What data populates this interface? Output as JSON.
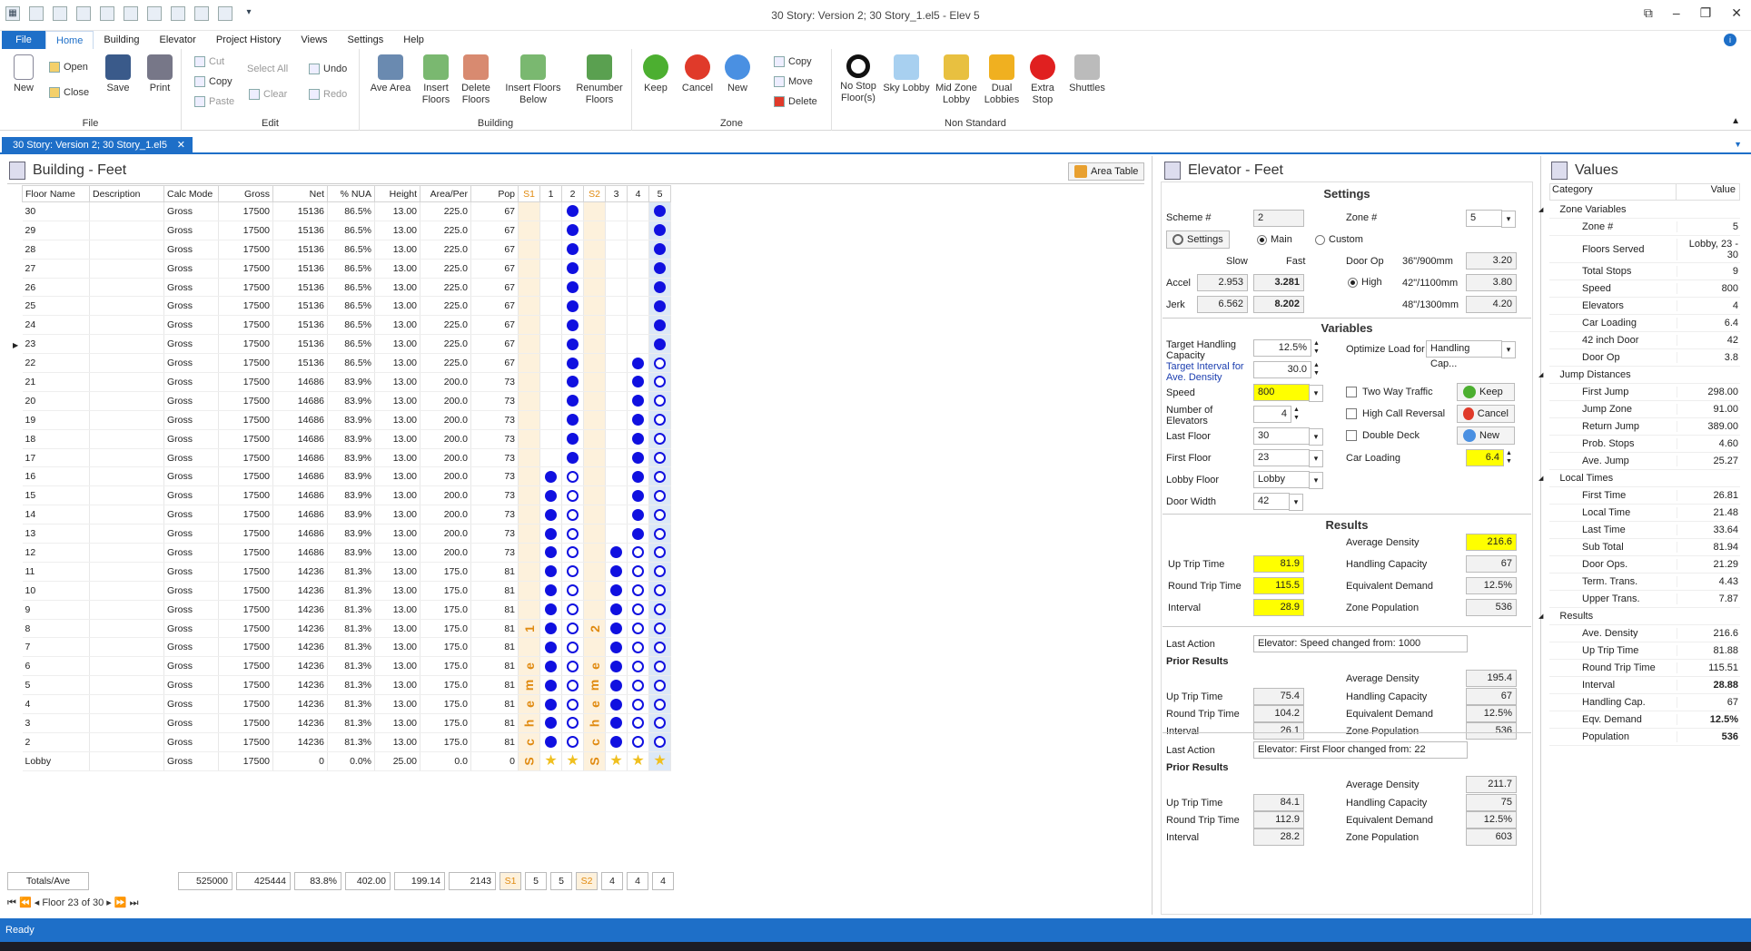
{
  "window": {
    "title": "30 Story: Version 2; 30 Story_1.el5 - Elev 5"
  },
  "menu": [
    "File",
    "Home",
    "Building",
    "Elevator",
    "Project History",
    "Views",
    "Settings",
    "Help"
  ],
  "ribbon": {
    "file": {
      "label": "File",
      "new": "New",
      "open": "Open",
      "close": "Close",
      "save": "Save",
      "print": "Print"
    },
    "edit": {
      "label": "Edit",
      "cut": "Cut",
      "copy": "Copy",
      "paste": "Paste",
      "select_all": "Select All",
      "clear": "Clear",
      "undo": "Undo",
      "redo": "Redo"
    },
    "building": {
      "label": "Building",
      "ave_area": "Ave Area",
      "insert_floors": "Insert Floors",
      "delete_floors": "Delete Floors",
      "insert_below": "Insert Floors Below",
      "renumber": "Renumber Floors"
    },
    "zone": {
      "label": "Zone",
      "keep": "Keep",
      "cancel": "Cancel",
      "new": "New",
      "copy": "Copy",
      "move": "Move",
      "delete": "Delete"
    },
    "nonstd": {
      "label": "Non Standard",
      "no_stop": "No Stop Floor(s)",
      "sky": "Sky Lobby",
      "mid": "Mid Zone Lobby",
      "dual": "Dual Lobbies",
      "extra": "Extra Stop",
      "shuttles": "Shuttles"
    }
  },
  "doc_tab": "30 Story: Version 2; 30 Story_1.el5",
  "building": {
    "title": "Building - Feet",
    "area_table_btn": "Area Table",
    "columns": [
      "Floor Name",
      "Description",
      "Calc Mode",
      "Gross",
      "Net",
      "% NUA",
      "Height",
      "Area/Per",
      "Pop",
      "S1",
      "1",
      "2",
      "S2",
      "3",
      "4",
      "5"
    ],
    "rows": [
      {
        "f": "30",
        "net": "15136",
        "nua": "86.5%",
        "ap": "225.0",
        "pop": "67",
        "z": [
          "",
          "",
          "f",
          "",
          "",
          "",
          "f"
        ]
      },
      {
        "f": "29",
        "net": "15136",
        "nua": "86.5%",
        "ap": "225.0",
        "pop": "67",
        "z": [
          "",
          "",
          "f",
          "",
          "",
          "",
          "f"
        ]
      },
      {
        "f": "28",
        "net": "15136",
        "nua": "86.5%",
        "ap": "225.0",
        "pop": "67",
        "z": [
          "",
          "",
          "f",
          "",
          "",
          "",
          "f"
        ]
      },
      {
        "f": "27",
        "net": "15136",
        "nua": "86.5%",
        "ap": "225.0",
        "pop": "67",
        "z": [
          "",
          "",
          "f",
          "",
          "",
          "",
          "f"
        ]
      },
      {
        "f": "26",
        "net": "15136",
        "nua": "86.5%",
        "ap": "225.0",
        "pop": "67",
        "z": [
          "",
          "",
          "f",
          "",
          "",
          "",
          "f"
        ]
      },
      {
        "f": "25",
        "net": "15136",
        "nua": "86.5%",
        "ap": "225.0",
        "pop": "67",
        "z": [
          "",
          "",
          "f",
          "",
          "",
          "",
          "f"
        ]
      },
      {
        "f": "24",
        "net": "15136",
        "nua": "86.5%",
        "ap": "225.0",
        "pop": "67",
        "z": [
          "",
          "",
          "f",
          "",
          "",
          "",
          "f"
        ]
      },
      {
        "f": "23",
        "net": "15136",
        "nua": "86.5%",
        "ap": "225.0",
        "pop": "67",
        "z": [
          "",
          "",
          "f",
          "",
          "",
          "",
          "f"
        ]
      },
      {
        "f": "22",
        "net": "15136",
        "nua": "86.5%",
        "ap": "225.0",
        "pop": "67",
        "z": [
          "",
          "",
          "f",
          "",
          "",
          "f",
          "o"
        ]
      },
      {
        "f": "21",
        "net": "14686",
        "nua": "83.9%",
        "ap": "200.0",
        "pop": "73",
        "z": [
          "",
          "",
          "f",
          "",
          "",
          "f",
          "o"
        ]
      },
      {
        "f": "20",
        "net": "14686",
        "nua": "83.9%",
        "ap": "200.0",
        "pop": "73",
        "z": [
          "",
          "",
          "f",
          "",
          "",
          "f",
          "o"
        ]
      },
      {
        "f": "19",
        "net": "14686",
        "nua": "83.9%",
        "ap": "200.0",
        "pop": "73",
        "z": [
          "",
          "",
          "f",
          "",
          "",
          "f",
          "o"
        ]
      },
      {
        "f": "18",
        "net": "14686",
        "nua": "83.9%",
        "ap": "200.0",
        "pop": "73",
        "z": [
          "",
          "",
          "f",
          "",
          "",
          "f",
          "o"
        ]
      },
      {
        "f": "17",
        "net": "14686",
        "nua": "83.9%",
        "ap": "200.0",
        "pop": "73",
        "z": [
          "",
          "",
          "f",
          "",
          "",
          "f",
          "o"
        ]
      },
      {
        "f": "16",
        "net": "14686",
        "nua": "83.9%",
        "ap": "200.0",
        "pop": "73",
        "z": [
          "",
          "f",
          "o",
          "",
          "",
          "f",
          "o"
        ]
      },
      {
        "f": "15",
        "net": "14686",
        "nua": "83.9%",
        "ap": "200.0",
        "pop": "73",
        "z": [
          "",
          "f",
          "o",
          "",
          "",
          "f",
          "o"
        ]
      },
      {
        "f": "14",
        "net": "14686",
        "nua": "83.9%",
        "ap": "200.0",
        "pop": "73",
        "z": [
          "",
          "f",
          "o",
          "",
          "",
          "f",
          "o"
        ]
      },
      {
        "f": "13",
        "net": "14686",
        "nua": "83.9%",
        "ap": "200.0",
        "pop": "73",
        "z": [
          "",
          "f",
          "o",
          "",
          "",
          "f",
          "o"
        ]
      },
      {
        "f": "12",
        "net": "14686",
        "nua": "83.9%",
        "ap": "200.0",
        "pop": "73",
        "z": [
          "",
          "f",
          "o",
          "",
          "f",
          "o",
          "o"
        ]
      },
      {
        "f": "11",
        "net": "14236",
        "nua": "81.3%",
        "ap": "175.0",
        "pop": "81",
        "z": [
          "",
          "f",
          "o",
          "",
          "f",
          "o",
          "o"
        ]
      },
      {
        "f": "10",
        "net": "14236",
        "nua": "81.3%",
        "ap": "175.0",
        "pop": "81",
        "z": [
          "",
          "f",
          "o",
          "",
          "f",
          "o",
          "o"
        ]
      },
      {
        "f": "9",
        "net": "14236",
        "nua": "81.3%",
        "ap": "175.0",
        "pop": "81",
        "z": [
          "",
          "f",
          "o",
          "",
          "f",
          "o",
          "o"
        ]
      },
      {
        "f": "8",
        "net": "14236",
        "nua": "81.3%",
        "ap": "175.0",
        "pop": "81",
        "z": [
          "1",
          "f",
          "o",
          "2",
          "f",
          "o",
          "o"
        ]
      },
      {
        "f": "7",
        "net": "14236",
        "nua": "81.3%",
        "ap": "175.0",
        "pop": "81",
        "z": [
          "",
          "f",
          "o",
          "",
          "f",
          "o",
          "o"
        ]
      },
      {
        "f": "6",
        "net": "14236",
        "nua": "81.3%",
        "ap": "175.0",
        "pop": "81",
        "z": [
          "e",
          "f",
          "o",
          "e",
          "f",
          "o",
          "o"
        ]
      },
      {
        "f": "5",
        "net": "14236",
        "nua": "81.3%",
        "ap": "175.0",
        "pop": "81",
        "z": [
          "m",
          "f",
          "o",
          "m",
          "f",
          "o",
          "o"
        ]
      },
      {
        "f": "4",
        "net": "14236",
        "nua": "81.3%",
        "ap": "175.0",
        "pop": "81",
        "z": [
          "e",
          "f",
          "o",
          "e",
          "f",
          "o",
          "o"
        ]
      },
      {
        "f": "3",
        "net": "14236",
        "nua": "81.3%",
        "ap": "175.0",
        "pop": "81",
        "z": [
          "h",
          "f",
          "o",
          "h",
          "f",
          "o",
          "o"
        ]
      },
      {
        "f": "2",
        "net": "14236",
        "nua": "81.3%",
        "ap": "175.0",
        "pop": "81",
        "z": [
          "c",
          "f",
          "o",
          "c",
          "f",
          "o",
          "o"
        ]
      },
      {
        "f": "Lobby",
        "net": "0",
        "nua": "0.0%",
        "ap": "0.0",
        "pop": "0",
        "h": "25.00",
        "z": [
          "S",
          "s",
          "s",
          "S",
          "s",
          "s",
          "s"
        ]
      }
    ],
    "calc_mode": "Gross",
    "gross": "17500",
    "height": "13.00",
    "totals": {
      "label": "Totals/Ave",
      "gross": "525000",
      "net": "425444",
      "nua": "83.8%",
      "height": "402.00",
      "ap": "199.14",
      "pop": "2143",
      "z": [
        "S1",
        "5",
        "5",
        "S2",
        "4",
        "4",
        "4"
      ]
    },
    "nav": "Floor 23 of 30"
  },
  "elevator": {
    "title": "Elevator - Feet",
    "settings": {
      "heading": "Settings",
      "scheme_label": "Scheme #",
      "scheme": "2",
      "zone_label": "Zone #",
      "zone": "5",
      "settings_btn": "Settings",
      "main": "Main",
      "custom": "Custom",
      "slow": "Slow",
      "fast": "Fast",
      "door_op": "Door Op",
      "accel_label": "Accel",
      "accel_slow": "2.953",
      "accel_fast": "3.281",
      "jerk_label": "Jerk",
      "jerk_slow": "6.562",
      "jerk_fast": "8.202",
      "high": "High",
      "d36": "36\"/900mm",
      "d36v": "3.20",
      "d42": "42\"/1100mm",
      "d42v": "3.80",
      "d48": "48\"/1300mm",
      "d48v": "4.20"
    },
    "variables": {
      "heading": "Variables",
      "thc_label": "Target Handling Capacity",
      "thc": "12.5%",
      "ti_label": "Target Interval for Ave. Density",
      "ti": "30.0",
      "speed_label": "Speed",
      "speed": "800",
      "num_label": "Number of Elevators",
      "num": "4",
      "last_label": "Last Floor",
      "last": "30",
      "first_label": "First Floor",
      "first": "23",
      "lobby_label": "Lobby Floor",
      "lobby": "Lobby",
      "door_label": "Door Width",
      "door": "42",
      "optimize_label": "Optimize Load for",
      "optimize": "Handling Cap...",
      "two_way": "Two Way Traffic",
      "high_call": "High Call Reversal",
      "double_deck": "Double Deck",
      "car_label": "Car Loading",
      "car": "6.4",
      "keep": "Keep",
      "cancel": "Cancel",
      "new": "New"
    },
    "results": {
      "heading": "Results",
      "avg_density_label": "Average Density",
      "avg_density": "216.6",
      "up_label": "Up Trip Time",
      "up": "81.9",
      "hc_label": "Handling Capacity",
      "hc": "67",
      "rt_label": "Round Trip Time",
      "rt": "115.5",
      "ed_label": "Equivalent Demand",
      "ed": "12.5%",
      "int_label": "Interval",
      "int": "28.9",
      "zp_label": "Zone Population",
      "zp": "536"
    },
    "history": [
      {
        "last_action_label": "Last Action",
        "last_action": "Elevator: Speed changed from: 1000",
        "prior": "Prior Results",
        "avg_density": "195.4",
        "up": "75.4",
        "hc": "67",
        "rt": "104.2",
        "ed": "12.5%",
        "int": "26.1",
        "zp": "536"
      },
      {
        "last_action_label": "Last Action",
        "last_action": "Elevator: First Floor changed from: 22",
        "prior": "Prior Results",
        "avg_density": "211.7",
        "up": "84.1",
        "hc": "75",
        "rt": "112.9",
        "ed": "12.5%",
        "int": "28.2",
        "zp": "603"
      }
    ]
  },
  "values": {
    "title": "Values",
    "col_category": "Category",
    "col_value": "Value",
    "rows": [
      {
        "k": "Zone Variables",
        "cat": true,
        "v": ""
      },
      {
        "k": "Zone #",
        "v": "5"
      },
      {
        "k": "Floors Served",
        "v": "Lobby, 23 - 30",
        "tall": true
      },
      {
        "k": "Total Stops",
        "v": "9"
      },
      {
        "k": "Speed",
        "v": "800"
      },
      {
        "k": "Elevators",
        "v": "4"
      },
      {
        "k": "Car Loading",
        "v": "6.4"
      },
      {
        "k": "42 inch Door",
        "v": "42"
      },
      {
        "k": "Door Op",
        "v": "3.8"
      },
      {
        "k": "Jump Distances",
        "cat": true,
        "v": ""
      },
      {
        "k": "First Jump",
        "v": "298.00"
      },
      {
        "k": "Jump Zone",
        "v": "91.00"
      },
      {
        "k": "Return Jump",
        "v": "389.00"
      },
      {
        "k": "Prob. Stops",
        "v": "4.60"
      },
      {
        "k": "Ave. Jump",
        "v": "25.27"
      },
      {
        "k": "Local Times",
        "cat": true,
        "v": ""
      },
      {
        "k": "First Time",
        "v": "26.81"
      },
      {
        "k": "Local Time",
        "v": "21.48"
      },
      {
        "k": "Last Time",
        "v": "33.64"
      },
      {
        "k": "Sub Total",
        "v": "81.94"
      },
      {
        "k": "Door Ops.",
        "v": "21.29"
      },
      {
        "k": "Term. Trans.",
        "v": "4.43"
      },
      {
        "k": "Upper Trans.",
        "v": "7.87"
      },
      {
        "k": "Results",
        "cat": true,
        "v": ""
      },
      {
        "k": "Ave. Density",
        "v": "216.6"
      },
      {
        "k": "Up Trip Time",
        "v": "81.88"
      },
      {
        "k": "Round Trip Time",
        "v": "115.51"
      },
      {
        "k": "Interval",
        "v": "28.88",
        "bold": true
      },
      {
        "k": "Handling Cap.",
        "v": "67"
      },
      {
        "k": "Eqv. Demand",
        "v": "12.5%",
        "bold": true
      },
      {
        "k": "Population",
        "v": "536",
        "bold": true
      }
    ]
  },
  "status": "Ready"
}
